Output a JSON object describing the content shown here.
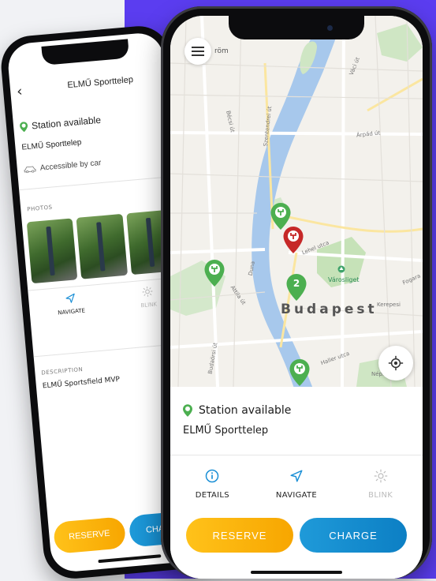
{
  "colors": {
    "background": "#f1f2f5",
    "accent_purple": "#5b3df0",
    "available_green": "#4caf50",
    "selected_red": "#c62828",
    "reserve_yellow": "#f7a600",
    "charge_blue": "#0c7fc4",
    "action_blue": "#1a8fd6",
    "disabled_grey": "#bbbbbb"
  },
  "detail_phone": {
    "header": {
      "back_icon": "chevron-left-icon",
      "title": "ELMŰ Sporttelep"
    },
    "status": {
      "icon": "charging-pin-icon",
      "text": "Station available"
    },
    "name": "ELMŰ Sporttelep",
    "access": {
      "icon": "car-icon",
      "text": "Accessible by car"
    },
    "photos_label": "PHOTOS",
    "photos": [
      "photo-1",
      "photo-2",
      "photo-3"
    ],
    "actions": [
      {
        "label": "NAVIGATE",
        "icon": "navigate-arrow-icon",
        "enabled": true
      },
      {
        "label": "BLINK",
        "icon": "sun-blink-icon",
        "enabled": false
      }
    ],
    "description_label": "DESCRIPTION",
    "description": "ELMŰ Sportsfield MVP",
    "buttons": {
      "reserve": "RESERVE",
      "charge": "CHARGE"
    }
  },
  "map_phone": {
    "menu_icon": "hamburger-menu-icon",
    "locate_icon": "locate-crosshair-icon",
    "map_labels": {
      "city": "Budapest",
      "district": "Városliget",
      "top_fragment": "röm",
      "streets": [
        "Váci út",
        "Árpád út",
        "Bécsi út",
        "Szentendrei út",
        "Lehel utca",
        "Attila út",
        "Duna",
        "Budaörsi út",
        "Haller utca",
        "Kerepesi",
        "Fogara",
        "Népli"
      ]
    },
    "pins": [
      {
        "type": "available"
      },
      {
        "type": "selected"
      },
      {
        "type": "available"
      },
      {
        "type": "cluster",
        "count": "2"
      },
      {
        "type": "available"
      }
    ],
    "sheet": {
      "status": {
        "icon": "charging-pin-icon",
        "text": "Station available"
      },
      "name": "ELMŰ Sporttelep",
      "actions": [
        {
          "label": "DETAILS",
          "icon": "info-icon",
          "enabled": true
        },
        {
          "label": "NAVIGATE",
          "icon": "navigate-arrow-icon",
          "enabled": true
        },
        {
          "label": "BLINK",
          "icon": "sun-blink-icon",
          "enabled": false
        }
      ],
      "buttons": {
        "reserve": "RESERVE",
        "charge": "CHARGE"
      }
    }
  }
}
